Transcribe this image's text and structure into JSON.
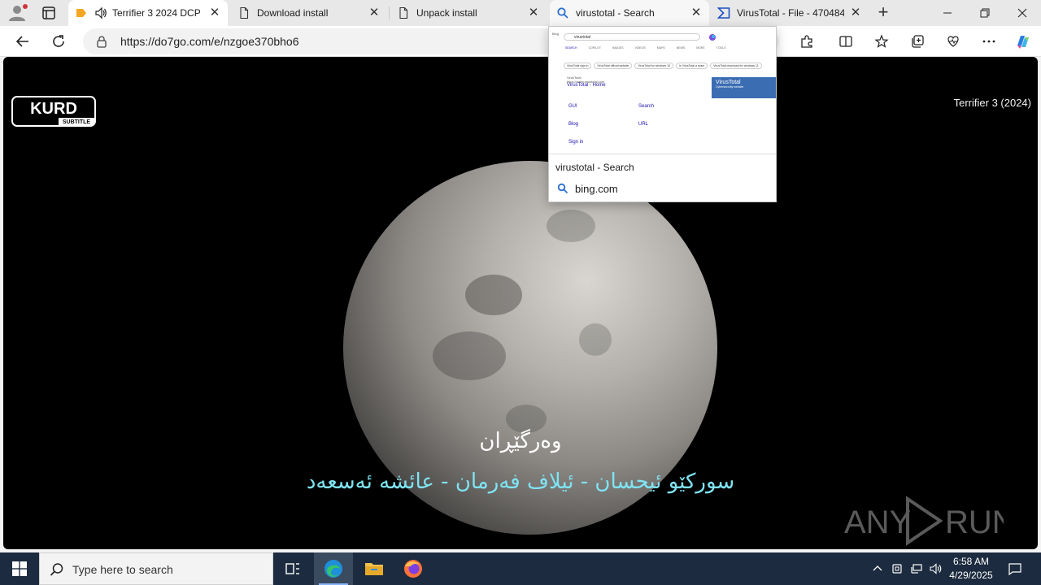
{
  "browser": {
    "tabs": [
      {
        "title": "Terrifier 3 2024 DCP",
        "favicon": "orange-site-icon",
        "audio": true,
        "state": "active"
      },
      {
        "title": "Download install",
        "favicon": "page-icon",
        "state": "normal"
      },
      {
        "title": "Unpack install",
        "favicon": "page-icon",
        "state": "normal"
      },
      {
        "title": "virustotal - Search",
        "favicon": "search-icon",
        "state": "hover"
      },
      {
        "title": "VirusTotal - File - 470484",
        "favicon": "virustotal-icon",
        "state": "normal"
      }
    ],
    "url": "https://do7go.com/e/nzgoe370bho6",
    "accent_color": "#0078d4"
  },
  "video": {
    "movie_title": "Terrifier 3 (2024)",
    "logo_text": "KURD",
    "logo_subtext": "SUBTITLE",
    "subtitle_line1": "وەرگێڕان",
    "subtitle_line2": "سورکێو ئیحسان - ئیلاف فەرمان - عائشە ئەسعەد",
    "subtitle_line2_color": "#7fe4f3",
    "watermark": "ANY RUN"
  },
  "preview": {
    "title": "virustotal - Search",
    "host": "bing.com",
    "thumbnail": {
      "query": "virustotal",
      "nav": [
        "SEARCH",
        "COPILOT",
        "IMAGES",
        "VIDEOS",
        "MAPS",
        "NEWS",
        "MORE",
        "TOOLS"
      ],
      "chips": [
        "VirusTotal sign in",
        "VirusTotal official website",
        "VirusTotal for windows 10",
        "Is VirusTotal a scam",
        "VirusTotal download for windows 11"
      ],
      "result_site": "VirusTotal",
      "result_url": "https://www.virustotal.com",
      "result_title": "VirusTotal - Home",
      "sublinks": [
        "GUI",
        "Search",
        "Blog",
        "URL",
        "Sign in"
      ],
      "panel_title": "VirusTotal",
      "panel_subtitle": "Cybersecurity website"
    }
  },
  "taskbar": {
    "search_placeholder": "Type here to search",
    "time": "6:58 AM",
    "date": "4/29/2025"
  }
}
